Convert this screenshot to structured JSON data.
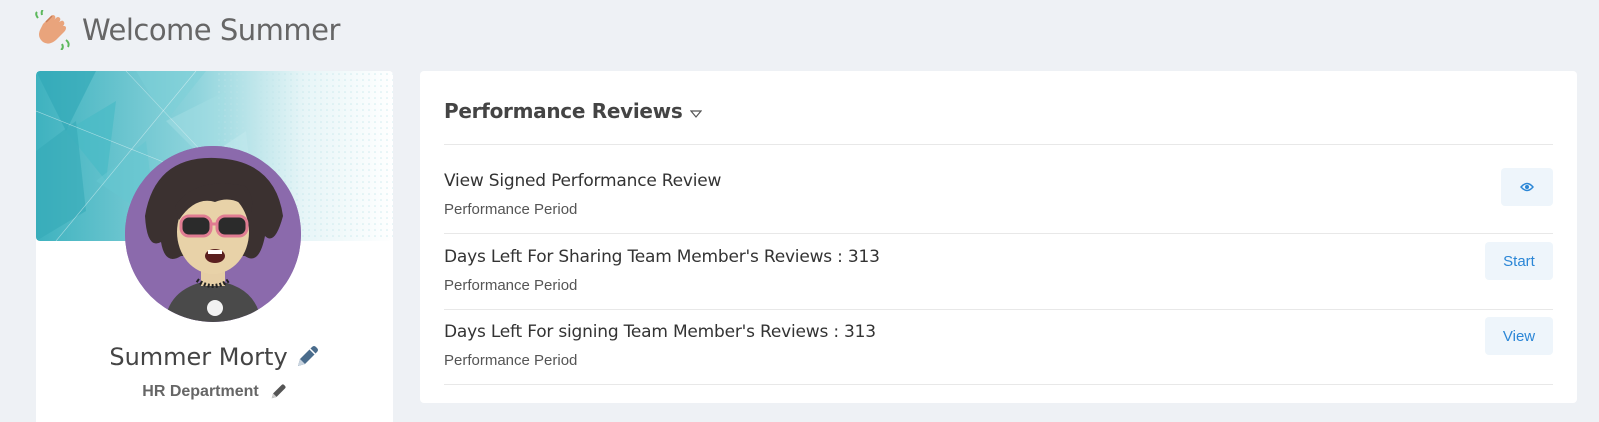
{
  "header": {
    "welcome_text": "Welcome Summer",
    "wave_icon": "waving-hand-icon"
  },
  "profile": {
    "name": "Summer Morty",
    "department": "HR Department"
  },
  "performance": {
    "title": "Performance Reviews",
    "reviews": [
      {
        "title": "View Signed Performance Review",
        "subtitle": "Performance Period",
        "action_icon": "eye-icon",
        "action_label": ""
      },
      {
        "title": "Days Left For Sharing Team Member's Reviews : 313",
        "subtitle": "Performance Period",
        "action_label": "Start"
      },
      {
        "title": "Days Left For signing Team Member's Reviews : 313",
        "subtitle": "Performance Period",
        "action_label": "View"
      }
    ]
  },
  "colors": {
    "background": "#eef1f5",
    "accent": "#2b86d6",
    "button_bg": "#eef5fb",
    "banner_teal": "#5ec4cf",
    "avatar_purple": "#8b6aac"
  }
}
